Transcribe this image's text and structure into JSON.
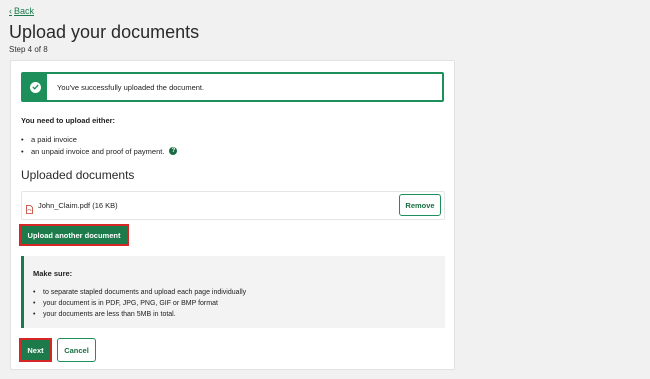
{
  "nav": {
    "back_label": "Back",
    "back_icon": "chevron-left"
  },
  "header": {
    "title": "Upload your documents",
    "step": "Step 4 of 8"
  },
  "alert": {
    "message": "You've successfully uploaded the document.",
    "icon": "check-circle",
    "color": "#1d8f5a"
  },
  "requirements": {
    "title": "You need to upload either:",
    "items": [
      "a paid invoice",
      "an unpaid invoice and proof of payment."
    ],
    "help_icon": "question-circle"
  },
  "uploaded": {
    "heading": "Uploaded documents",
    "files": [
      {
        "name": "John_Claim.pdf (16 KB)",
        "icon": "pdf-file",
        "remove_label": "Remove"
      }
    ],
    "upload_another_label": "Upload another document"
  },
  "make_sure": {
    "title": "Make sure:",
    "items": [
      "to separate stapled documents and upload each page individually",
      "your document is in PDF, JPG, PNG, GIF or BMP format",
      "your documents are less than 5MB in total."
    ]
  },
  "actions": {
    "next_label": "Next",
    "cancel_label": "Cancel"
  },
  "colors": {
    "accent": "#1d7a4b",
    "highlight_border": "#d62626",
    "background": "#f1f1f1"
  }
}
